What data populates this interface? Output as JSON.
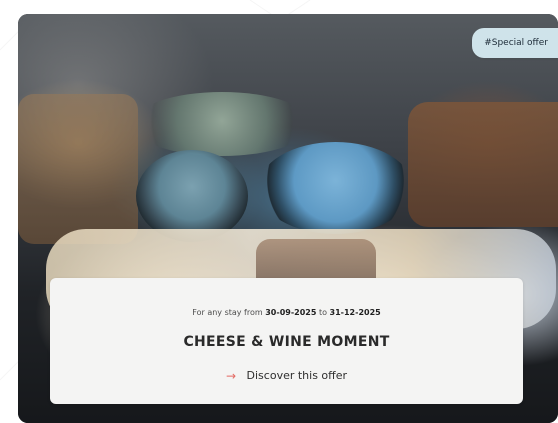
{
  "card": {
    "tag_label": "#Special offer",
    "stay_prefix": "For any stay from",
    "date_start": "30-09-2025",
    "date_connector": "to",
    "date_end": "31-12-2025",
    "title": "CHEESE & WINE MOMENT",
    "cta_label": "Discover this offer",
    "arrow_icon": "arrow-right-icon",
    "accent_color": "#e36a63",
    "tag_color": "#cfe3ea"
  }
}
